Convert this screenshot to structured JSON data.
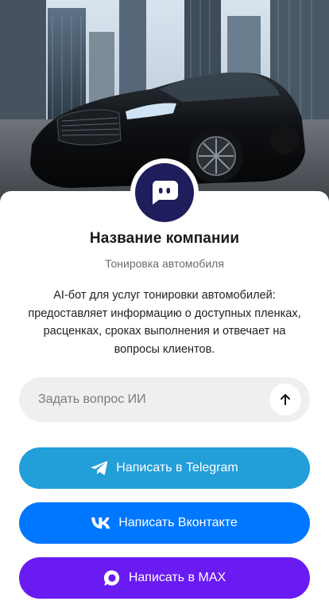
{
  "company": {
    "name": "Название компании",
    "subtitle": "Тонировка автомобиля",
    "description": "AI-бот для услуг тонировки автомобилей: предоставляет информацию о доступных пленках, расценках, сроках выполнения и отвечает на вопросы клиентов."
  },
  "ask": {
    "placeholder": "Задать вопрос ИИ",
    "send_icon": "arrow-up-icon"
  },
  "buttons": {
    "telegram": {
      "label": "Написать в Telegram",
      "icon": "telegram-icon",
      "color": "#229ed9"
    },
    "vk": {
      "label": "Написать Вконтакте",
      "icon": "vk-icon",
      "color": "#0077ff"
    },
    "max": {
      "label": "Написать в MAX",
      "icon": "max-icon",
      "color": "#6a1bf2"
    }
  },
  "colors": {
    "avatar_bg": "#1f1d5c",
    "ask_bg": "#efefef"
  }
}
